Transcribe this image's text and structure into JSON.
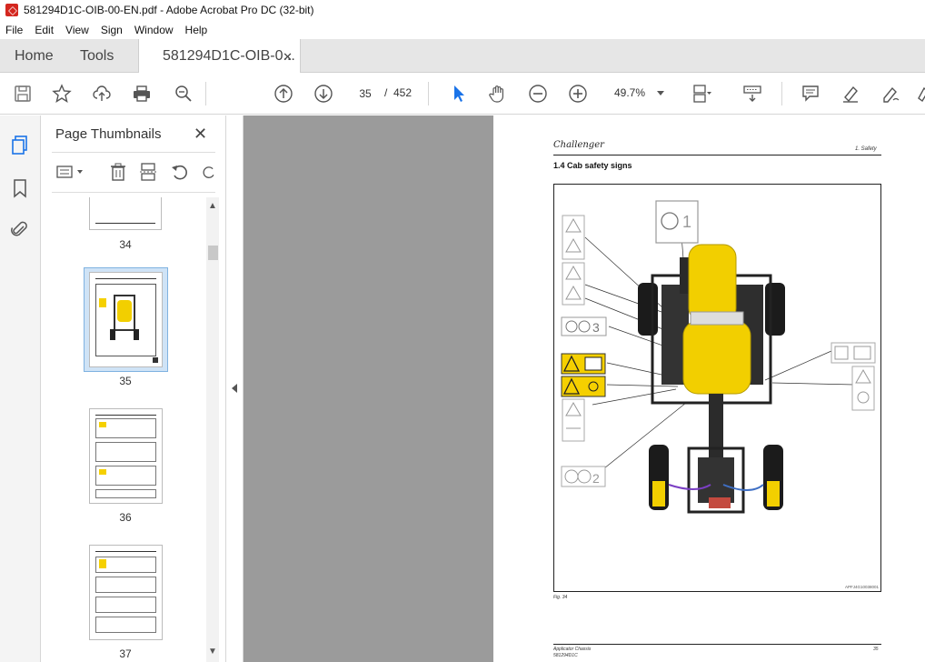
{
  "window": {
    "title": "581294D1C-OIB-00-EN.pdf - Adobe Acrobat Pro DC (32-bit)"
  },
  "menu": {
    "items": [
      "File",
      "Edit",
      "View",
      "Sign",
      "Window",
      "Help"
    ]
  },
  "tabs": {
    "home": "Home",
    "tools": "Tools",
    "document": "581294D1C-OIB-0...",
    "close": "✕"
  },
  "toolbar": {
    "current_page": "35",
    "page_separator": "/",
    "total_pages": "452",
    "zoom": "49.7%"
  },
  "panel": {
    "title": "Page Thumbnails",
    "close": "✕",
    "thumbnails": [
      {
        "label": "34"
      },
      {
        "label": "35",
        "selected": true
      },
      {
        "label": "36"
      },
      {
        "label": "37"
      }
    ]
  },
  "document": {
    "brand": "Challenger",
    "header_right": "1. Safety",
    "section_title": "1.4   Cab safety signs",
    "figure_code": "APFJ4G10038001",
    "figure_caption": "Fig. 34",
    "footer_left_1": "Applicator Chassis",
    "footer_left_2": "581294D1C",
    "footer_right": "35"
  },
  "colors": {
    "accent_blue": "#1a73e8",
    "acrobat_red": "#d4271f",
    "tractor_yellow": "#f2cf00",
    "warning_yellow": "#f5d000",
    "selection": "#cfe3f6"
  }
}
